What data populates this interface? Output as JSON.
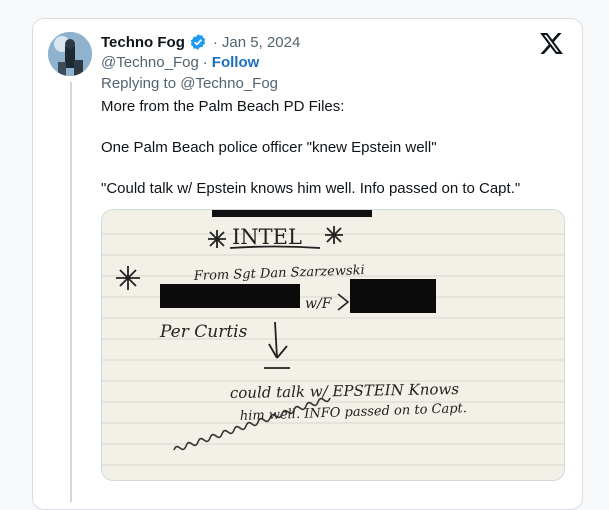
{
  "tweet": {
    "author_name": "Techno Fog",
    "date": "Jan 5, 2024",
    "handle": "@Techno_Fog",
    "follow_label": "Follow",
    "replying_prefix": "Replying to",
    "replying_handle": "@Techno_Fog",
    "lines": [
      "More from the Palm Beach PD Files:",
      "One Palm Beach police officer \"knew Epstein well\"",
      "\"Could talk w/ Epstein knows him well. Info passed on to Capt.\""
    ]
  },
  "note_image": {
    "heading": "INTEL",
    "from_line": "From Sgt Dan Szarzewski",
    "wf": "w/F",
    "per": "Per Curtis",
    "line1": "could talk w/ EPSTEIN Knows",
    "line2": "him well. INFO passed on to Capt."
  },
  "colors": {
    "verified": "#1d9bf0",
    "follow": "#1d6fbe",
    "muted": "#536471"
  },
  "icons": [
    "verified-badge-icon",
    "x-logo-icon"
  ]
}
